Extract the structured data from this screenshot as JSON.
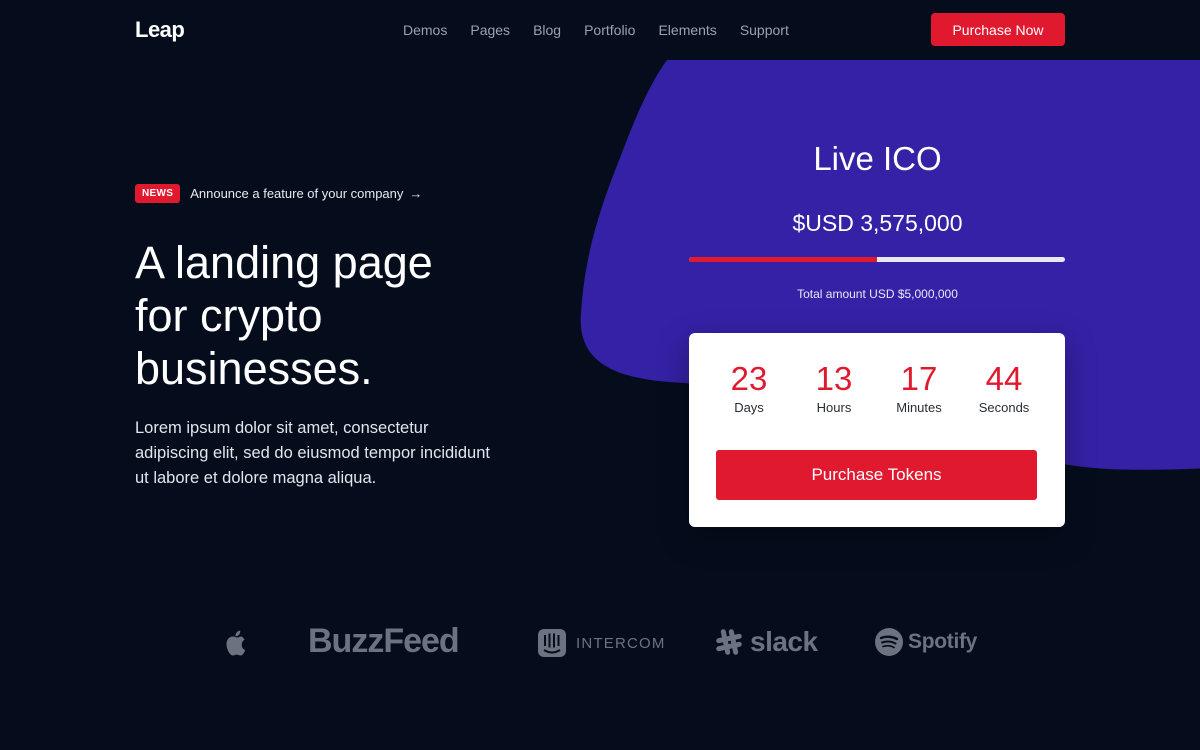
{
  "brand": {
    "logo": "Leap"
  },
  "nav": {
    "items": [
      "Demos",
      "Pages",
      "Blog",
      "Portfolio",
      "Elements",
      "Support"
    ],
    "cta_label": "Purchase Now"
  },
  "hero": {
    "news_badge": "NEWS",
    "news_text": "Announce a feature of your company",
    "news_arrow": "→",
    "headline_lines": [
      "A landing page",
      "for crypto",
      "businesses."
    ],
    "lead": "Lorem ipsum dolor sit amet, consectetur adipiscing elit, sed do eiusmod tempor incididunt ut labore et dolore magna aliqua."
  },
  "ico": {
    "title": "Live ICO",
    "amount": "$USD 3,575,000",
    "progress_fraction": 0.5,
    "total_text": "Total amount USD $5,000,000",
    "countdown": [
      {
        "value": "23",
        "label": "Days"
      },
      {
        "value": "13",
        "label": "Hours"
      },
      {
        "value": "17",
        "label": "Minutes"
      },
      {
        "value": "44",
        "label": "Seconds"
      }
    ],
    "button_label": "Purchase Tokens"
  },
  "logos": {
    "buzzfeed": "BuzzFeed",
    "intercom": "INTERCOM",
    "slack": "slack",
    "spotify": "Spotify"
  },
  "colors": {
    "background": "#050d1d",
    "accent": "#e0192f",
    "blob": "#3421a6",
    "muted": "#6c7380"
  }
}
